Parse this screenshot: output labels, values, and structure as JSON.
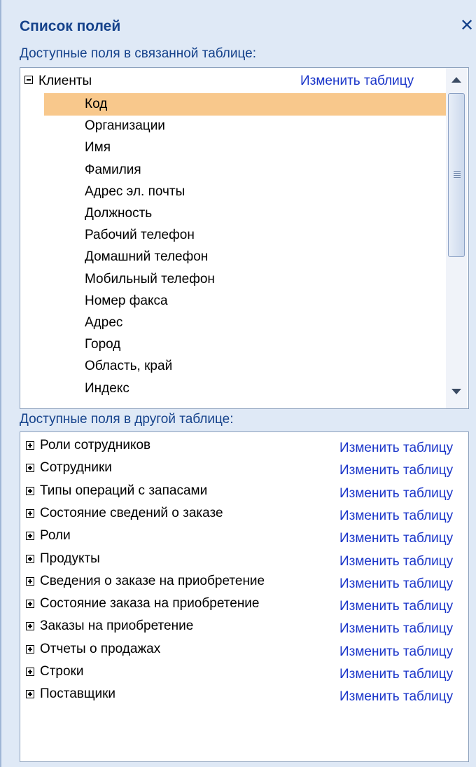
{
  "panel": {
    "title": "Список полей",
    "close_icon": "close-icon"
  },
  "linked": {
    "label": "Доступные поля в связанной таблице:",
    "group_name": "Клиенты",
    "edit_label": "Изменить таблицу",
    "fields": [
      "Код",
      "Организации",
      "Имя",
      "Фамилия",
      "Адрес эл. почты",
      "Должность",
      "Рабочий телефон",
      "Домашний телефон",
      "Мобильный телефон",
      "Номер факса",
      "Адрес",
      "Город",
      "Область, край",
      "Индекс"
    ],
    "selected_field": "Код"
  },
  "other": {
    "label": "Доступные поля в другой таблице:",
    "tables": [
      {
        "name": "Роли сотрудников",
        "edit_label": "Изменить таблицу"
      },
      {
        "name": "Сотрудники",
        "edit_label": "Изменить таблицу"
      },
      {
        "name": "Типы операций с запасами",
        "edit_label": "Изменить таблицу"
      },
      {
        "name": "Состояние сведений о заказе",
        "edit_label": "Изменить таблицу"
      },
      {
        "name": "Роли",
        "edit_label": "Изменить таблицу"
      },
      {
        "name": "Продукты",
        "edit_label": "Изменить таблицу"
      },
      {
        "name": "Сведения о заказе на приобретение",
        "edit_label": "Изменить таблицу"
      },
      {
        "name": "Состояние заказа на приобретение",
        "edit_label": "Изменить таблицу"
      },
      {
        "name": "Заказы на приобретение",
        "edit_label": "Изменить таблицу"
      },
      {
        "name": "Отчеты о продажах",
        "edit_label": "Изменить таблицу"
      },
      {
        "name": "Строки",
        "edit_label": "Изменить таблицу"
      },
      {
        "name": "Поставщики",
        "edit_label": "Изменить таблицу"
      }
    ]
  },
  "colors": {
    "title_text": "#15428b",
    "link": "#1a35c9",
    "selection": "#f8c88c",
    "pane_bg": "#dfe9f6"
  }
}
